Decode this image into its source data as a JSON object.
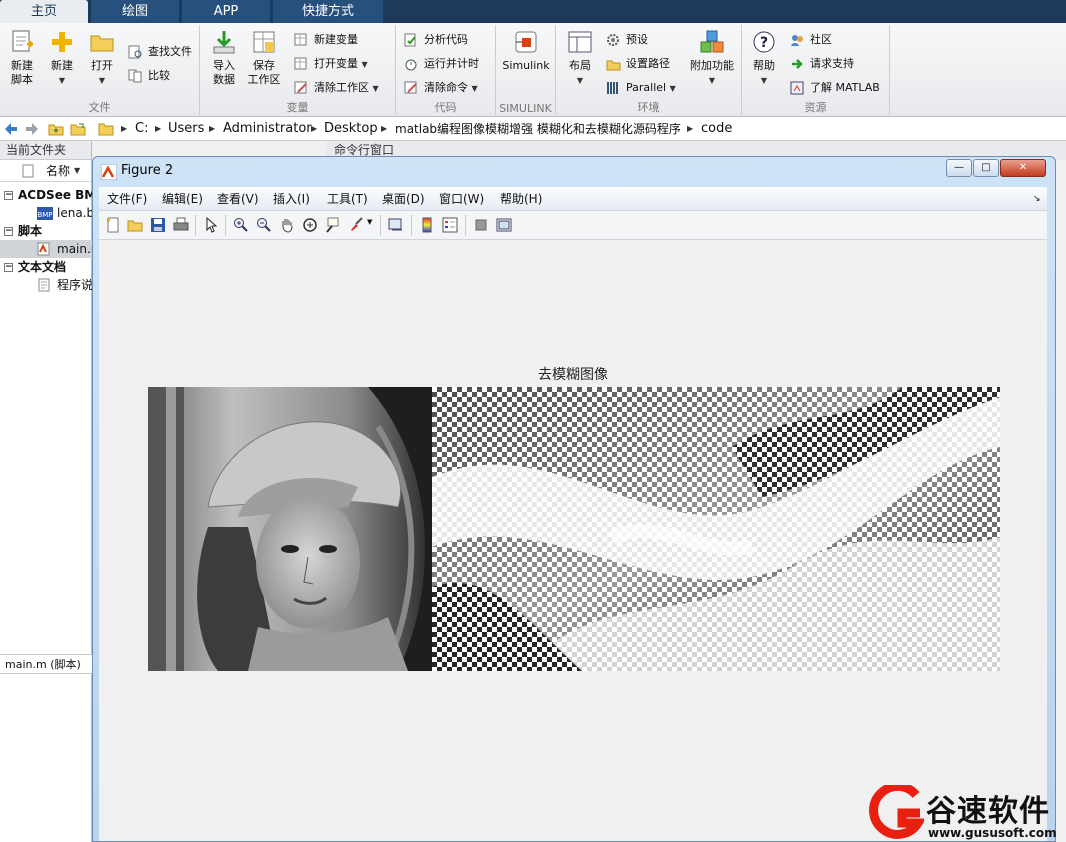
{
  "tabs": [
    {
      "label": "主页"
    },
    {
      "label": "绘图"
    },
    {
      "label": "APP"
    },
    {
      "label": "快捷方式"
    }
  ],
  "ribbon": {
    "file": {
      "label": "文件",
      "new_script": "新建\n脚本",
      "new": "新建",
      "open": "打开",
      "find_files": "查找文件",
      "compare": "比较"
    },
    "variable": {
      "label": "变量",
      "import": "导入\n数据",
      "save_ws": "保存\n工作区",
      "new_var": "新建变量",
      "open_var": "打开变量",
      "clear_ws": "清除工作区"
    },
    "code": {
      "label": "代码",
      "analyze": "分析代码",
      "run_time": "运行并计时",
      "clear_cmd": "清除命令"
    },
    "simulink": {
      "label": "SIMULINK",
      "btn": "Simulink"
    },
    "env": {
      "label": "环境",
      "layout": "布局",
      "prefs": "预设",
      "set_path": "设置路径",
      "parallel": "Parallel",
      "addons": "附加功能"
    },
    "res": {
      "label": "资源",
      "help": "帮助",
      "community": "社区",
      "support": "请求支持",
      "learn": "了解 MATLAB"
    }
  },
  "address": {
    "crumbs": [
      "C:",
      "Users",
      "Administrator",
      "Desktop",
      "matlab编程图像模糊增强 模糊化和去模糊化源码程序",
      "code"
    ]
  },
  "left": {
    "title": "当前文件夹",
    "name_col": "名称",
    "acdsee": "ACDSee BMP",
    "lena": "lena.bmp",
    "scripts": "脚本",
    "main": "main.m",
    "docs": "文本文档",
    "readme": "程序说明",
    "detail": "main.m  (脚本)"
  },
  "cmd": {
    "title": "命令行窗口"
  },
  "figure": {
    "title": "Figure 2",
    "menus": [
      "文件(F)",
      "编辑(E)",
      "查看(V)",
      "插入(I)",
      "工具(T)",
      "桌面(D)",
      "窗口(W)",
      "帮助(H)"
    ],
    "plot_title": "去模糊图像"
  },
  "watermark": {
    "name": "谷速软件",
    "url": "www.gususoft.com"
  },
  "colors": {
    "tabbar": "#1d3a5c",
    "accent": "#e8200f"
  }
}
